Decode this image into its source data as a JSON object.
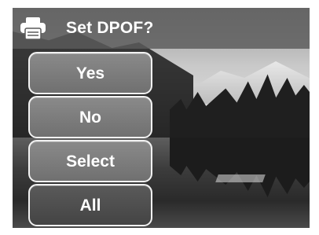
{
  "dialog": {
    "title": "Set DPOF?",
    "icon": "printer-icon"
  },
  "menu": {
    "items": [
      {
        "label": "Yes"
      },
      {
        "label": "No"
      },
      {
        "label": "Select"
      },
      {
        "label": "All"
      }
    ],
    "selected_label": "All"
  },
  "colors": {
    "button_fill": "#7a7a7a",
    "selected_fill": "#4a4a4a",
    "button_border": "#f2f2f2",
    "text": "#ffffff"
  }
}
